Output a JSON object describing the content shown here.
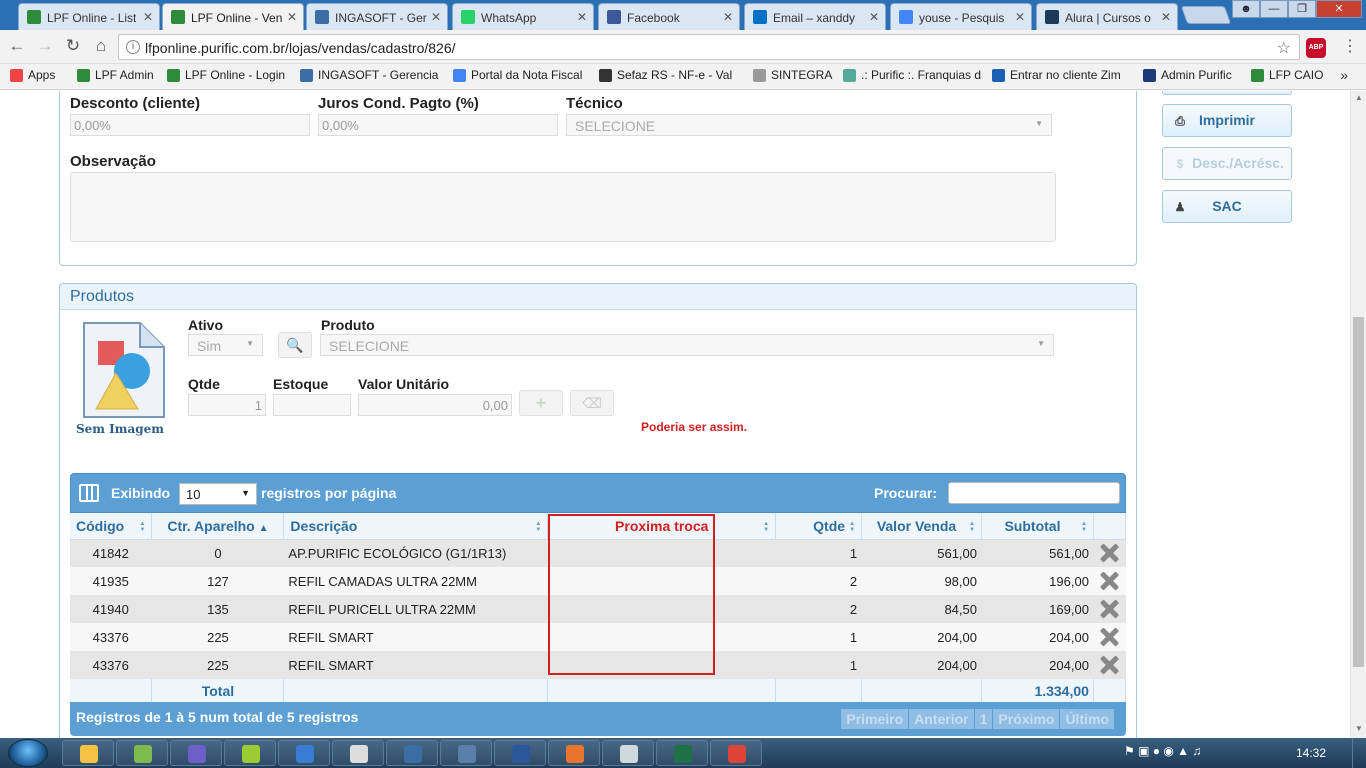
{
  "browser": {
    "tabs": [
      {
        "label": "LPF Online - List",
        "color": "#2e8b3a",
        "active": false
      },
      {
        "label": "LPF Online - Ven",
        "color": "#2e8b3a",
        "active": true
      },
      {
        "label": "INGASOFT - Ger",
        "color": "#3a6ea5",
        "active": false
      },
      {
        "label": "WhatsApp",
        "color": "#25d366",
        "active": false
      },
      {
        "label": "Facebook",
        "color": "#3b5998",
        "active": false
      },
      {
        "label": "Email – xanddy",
        "color": "#0072c6",
        "active": false
      },
      {
        "label": "youse - Pesquis",
        "color": "#4285f4",
        "active": false
      },
      {
        "label": "Alura | Cursos o",
        "color": "#1c3a5a",
        "active": false
      }
    ],
    "url": "lfponline.purific.com.br/lojas/vendas/cadastro/826/",
    "bookmarks": [
      {
        "label": "Apps",
        "color": "#e44"
      },
      {
        "label": "LPF Admin",
        "color": "#2e8b3a"
      },
      {
        "label": "LPF Online - Login",
        "color": "#2e8b3a"
      },
      {
        "label": "INGASOFT - Gerencia",
        "color": "#3a6ea5"
      },
      {
        "label": "Portal da Nota Fiscal",
        "color": "#4285f4"
      },
      {
        "label": "Sefaz RS - NF-e - Val",
        "color": "#333"
      },
      {
        "label": "SINTEGRA",
        "color": "#999"
      },
      {
        "label": ".: Purific :. Franquias d",
        "color": "#5a9"
      },
      {
        "label": "Entrar no cliente Zim",
        "color": "#1a5fb4"
      },
      {
        "label": "Admin Purific",
        "color": "#1c3a7a"
      },
      {
        "label": "LFP CAIO",
        "color": "#2e8b3a"
      }
    ],
    "abp_label": "ABP"
  },
  "form": {
    "desconto_label": "Desconto (cliente)",
    "desconto_value": "0,00%",
    "juros_label": "Juros Cond. Pagto (%)",
    "juros_value": "0,00%",
    "tecnico_label": "Técnico",
    "tecnico_value": "SELECIONE",
    "observacao_label": "Observação"
  },
  "side": {
    "imprimir": "Imprimir",
    "desc_acresc": "Desc./Acrésc.",
    "sac": "SAC"
  },
  "produtos": {
    "title": "Produtos",
    "sem_imagem": "Sem Imagem",
    "ativo_label": "Ativo",
    "ativo_value": "Sim",
    "produto_label": "Produto",
    "produto_value": "SELECIONE",
    "qtde_label": "Qtde",
    "qtde_value": "1",
    "estoque_label": "Estoque",
    "valor_label": "Valor Unitário",
    "valor_value": "0,00",
    "annotation": "Poderia ser assim."
  },
  "table": {
    "exibindo": "Exibindo",
    "page_size": "10",
    "registros_por_pagina": "registros por página",
    "procurar": "Procurar:",
    "columns": [
      "Código",
      "Ctr. Aparelho",
      "Descrição",
      "Proxima troca",
      "Qtde",
      "Valor Venda",
      "Subtotal"
    ],
    "rows": [
      {
        "codigo": "41842",
        "ctr": "0",
        "descricao": "AP.PURIFIC ECOLÓGICO (G1/1R13)",
        "proxima": "",
        "qtde": "1",
        "valor": "561,00",
        "subtotal": "561,00"
      },
      {
        "codigo": "41935",
        "ctr": "127",
        "descricao": "REFIL CAMADAS ULTRA 22MM",
        "proxima": "",
        "qtde": "2",
        "valor": "98,00",
        "subtotal": "196,00"
      },
      {
        "codigo": "41940",
        "ctr": "135",
        "descricao": "REFIL PURICELL ULTRA 22MM",
        "proxima": "",
        "qtde": "2",
        "valor": "84,50",
        "subtotal": "169,00"
      },
      {
        "codigo": "43376",
        "ctr": "225",
        "descricao": "REFIL SMART",
        "proxima": "",
        "qtde": "1",
        "valor": "204,00",
        "subtotal": "204,00"
      },
      {
        "codigo": "43376",
        "ctr": "225",
        "descricao": "REFIL SMART",
        "proxima": "",
        "qtde": "1",
        "valor": "204,00",
        "subtotal": "204,00"
      }
    ],
    "total_label": "Total",
    "total_value": "1.334,00",
    "info": "Registros de 1 à 5 num total de 5 registros",
    "pager": [
      "Primeiro",
      "Anterior",
      "1",
      "Próximo",
      "Último"
    ]
  },
  "taskbar": {
    "clock": "14:32",
    "apps": [
      "#f5c342",
      "#7dbb4e",
      "#6c5fc7",
      "#9acd32",
      "#3a7bd5",
      "#ddd",
      "#3a6ea5",
      "#5a7fa8",
      "#2b579a",
      "#e8742e",
      "#cfd8dc",
      "#1e7145",
      "#db4437"
    ]
  }
}
